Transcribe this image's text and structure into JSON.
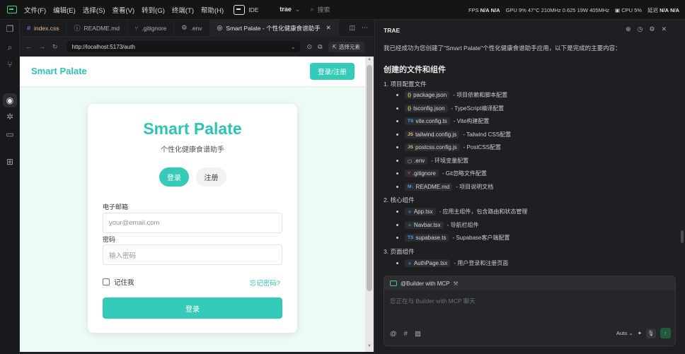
{
  "menubar": {
    "items": [
      "文件(F)",
      "编辑(E)",
      "选择(S)",
      "查看(V)",
      "转到(G)",
      "终端(T)",
      "帮助(H)"
    ],
    "ide_label": "IDE",
    "project": "trae",
    "search_placeholder": "搜索",
    "stats": {
      "fps_label": "FPS",
      "fps_value1": "N/A",
      "fps_value2": "N/A",
      "gpu_label": "GPU",
      "gpu_text": "9% 47°C 210MHz 0.625 19W 405MHz",
      "cpu_label": "CPU",
      "cpu_value": "5%",
      "latency_label": "延迟",
      "latency_value1": "N/A",
      "latency_value2": "N/A"
    }
  },
  "tabs": [
    {
      "icon": "#",
      "label": "index.css",
      "active": false
    },
    {
      "icon": "ⓘ",
      "label": "README.md",
      "active": false
    },
    {
      "icon": "⑂",
      "label": ".gitignore",
      "active": false
    },
    {
      "icon": "⚙",
      "label": ".env",
      "active": false
    },
    {
      "icon": "◎",
      "label": "Smart Palate - 个性化健康食谱助手",
      "active": true
    }
  ],
  "address": {
    "url": "http://localhost:5173/auth",
    "pick_label": "选择元素"
  },
  "app": {
    "brand": "Smart Palate",
    "header_button": "登录/注册",
    "card_title": "Smart Palate",
    "card_subtitle": "个性化健康食谱助手",
    "tab_login": "登录",
    "tab_register": "注册",
    "email_label": "电子邮箱",
    "email_placeholder": "your@email.com",
    "password_label": "密码",
    "password_placeholder": "输入密码",
    "remember_label": "记住我",
    "forgot_label": "忘记密码?",
    "submit_label": "登录"
  },
  "panel": {
    "title": "TRAE",
    "intro": "我已经成功为您创建了\"Smart Palate\"个性化健康食谱助手应用，以下是完成的主要内容：",
    "heading": "创建的文件和组件",
    "sections": [
      {
        "title": "1. 项目配置文件",
        "items": [
          {
            "icon": "{}",
            "kind": "json",
            "file": "package.json",
            "desc": "- 项目依赖和脚本配置"
          },
          {
            "icon": "{}",
            "kind": "json",
            "file": "tsconfig.json",
            "desc": "- TypeScript编译配置"
          },
          {
            "icon": "TS",
            "kind": "ts",
            "file": "vite.config.ts",
            "desc": "- Vite构建配置"
          },
          {
            "icon": "JS",
            "kind": "js",
            "file": "tailwind.config.js",
            "desc": "- Tailwind CSS配置"
          },
          {
            "icon": "JS",
            "kind": "js",
            "file": "postcss.config.js",
            "desc": "- PostCSS配置"
          },
          {
            "icon": "▢",
            "kind": "env",
            "file": ".env",
            "desc": "- 环境变量配置"
          },
          {
            "icon": "⑂",
            "kind": "git",
            "file": ".gitignore",
            "desc": "- Git忽略文件配置"
          },
          {
            "icon": "M↓",
            "kind": "md",
            "file": "README.md",
            "desc": "- 项目说明文档"
          }
        ]
      },
      {
        "title": "2. 核心组件",
        "items": [
          {
            "icon": "⚛",
            "kind": "ts",
            "file": "App.tsx",
            "desc": "- 应用主组件，包含路由和状态管理"
          },
          {
            "icon": "⚛",
            "kind": "ts",
            "file": "Navbar.tsx",
            "desc": "- 导航栏组件"
          },
          {
            "icon": "TS",
            "kind": "ts",
            "file": "supabase.ts",
            "desc": "- Supabase客户端配置"
          }
        ]
      },
      {
        "title": "3. 页面组件",
        "items": [
          {
            "icon": "⚛",
            "kind": "ts",
            "file": "AuthPage.tsx",
            "desc": "- 用户登录和注册页面"
          }
        ]
      }
    ],
    "composer": {
      "agent": "@Builder with MCP",
      "placeholder": "您正在与 Builder with MCP 聊天",
      "model": "Auto"
    }
  }
}
